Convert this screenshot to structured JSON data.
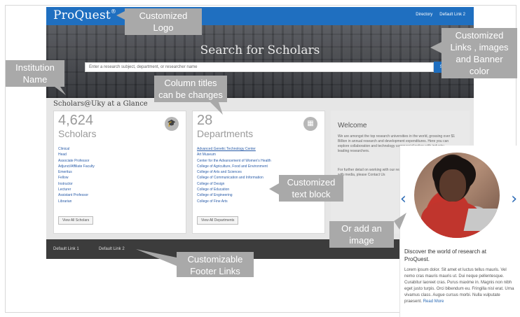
{
  "header": {
    "logo": "ProQuest",
    "logo_mark": "®",
    "top_links": [
      "Directory",
      "Default Link 2"
    ]
  },
  "hero": {
    "title": "Search for Scholars",
    "search_placeholder": "Enter a research subject, department, or researcher name",
    "search_button": "Search"
  },
  "institution": {
    "glance_title": "Scholars@Uky at a Glance"
  },
  "scholars_card": {
    "count": "4,624",
    "title": "Scholars",
    "icon": "graduation-cap-icon",
    "items": [
      "Clinical",
      "Head",
      "Associate Professor",
      "Adjunct/Affiliate Faculty",
      "Emeritus",
      "Fellow",
      "Instructor",
      "Lecturer",
      "Assistant Professor",
      "Librarian"
    ],
    "button": "View All Scholars"
  },
  "departments_card": {
    "count": "28",
    "title": "Departments",
    "icon": "building-icon",
    "items": [
      "Advanced Genetic Technology Center",
      "Art Museum",
      "Center for the Advancement of Women's Health",
      "College of Agriculture, Food and Environment",
      "College of Arts and Sciences",
      "College of Communication and Information",
      "College of Design",
      "College of Education",
      "College of Engineering",
      "College of Fine Arts"
    ],
    "button": "View All Departments"
  },
  "welcome": {
    "title": "Welcome",
    "p1": "We are amongst the top research universities in the world, grossing over $1 Billion in annual research and development expenditures. Here you can explore collaboration and technology commercialization with industry-leading researchers.",
    "p2": "For further detail on working with our researchers or collaboration, working with media, please Contact Us"
  },
  "footer": {
    "links": [
      "Default Link 1",
      "Default Link 2"
    ]
  },
  "callouts": {
    "logo": "Customized Logo",
    "links": "Customized Links , images and Banner color",
    "institution": "Institution Name",
    "columns": "Column titles can be changes",
    "text_block": "Customized text block",
    "image": "Or add an image",
    "footer": "Customizable Footer Links"
  },
  "promo": {
    "heading": "Discover the world of research at ProQuest.",
    "body": "Lorem ipsum dolor. Sit amet et luctus tellus mauris. Vel nemo cras mauris mauris ut. Dui neque pellentesque. Curabitur laoreet cras. Purus maxime in. Magnis non nibh eget justo turpis. Orci bibendum eu. Fringilla nisl erat. Urna vivamus class. Augue cursus morbi. Nulla vulputate praesent.",
    "read_more": "Read More",
    "prev_icon": "chevron-left-icon",
    "next_icon": "chevron-right-icon"
  }
}
